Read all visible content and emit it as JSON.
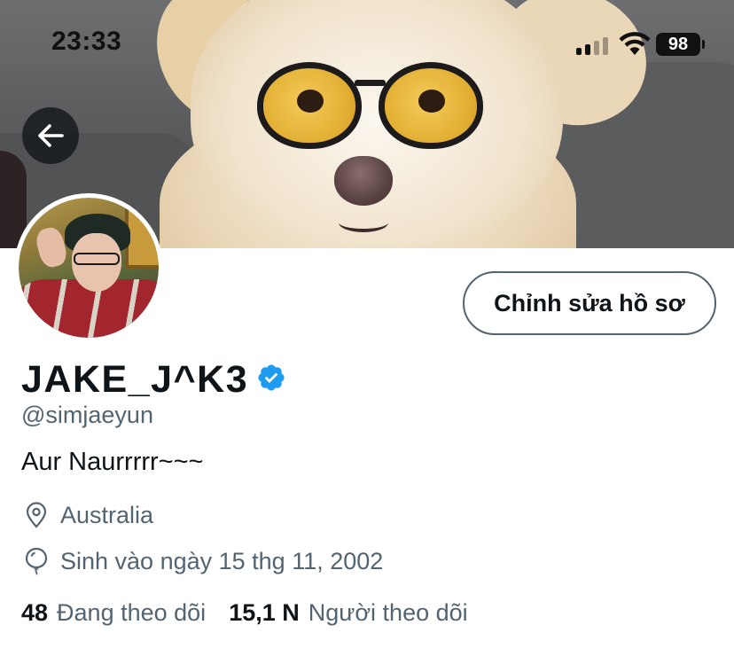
{
  "status_bar": {
    "time": "23:33",
    "battery": "98",
    "icons": [
      "cellular-signal-icon",
      "wifi-icon",
      "battery-icon"
    ]
  },
  "navigation": {
    "back_icon": "arrow-left-icon"
  },
  "profile": {
    "display_name": "JAKE_J^K3",
    "verified": true,
    "handle": "@simjaeyun",
    "bio": "Aur Naurrrrr~~~",
    "location": "Australia",
    "birth_date": "Sinh vào ngày 15 thg 11, 2002",
    "edit_button_label": "Chỉnh sửa hồ sơ",
    "following_count": "48",
    "following_label": "Đang theo dõi",
    "followers_count": "15,1 N",
    "followers_label": "Người theo dõi"
  },
  "colors": {
    "verified_blue": "#1d9bf0",
    "secondary_text": "#536471",
    "primary_text": "#0f1419"
  }
}
